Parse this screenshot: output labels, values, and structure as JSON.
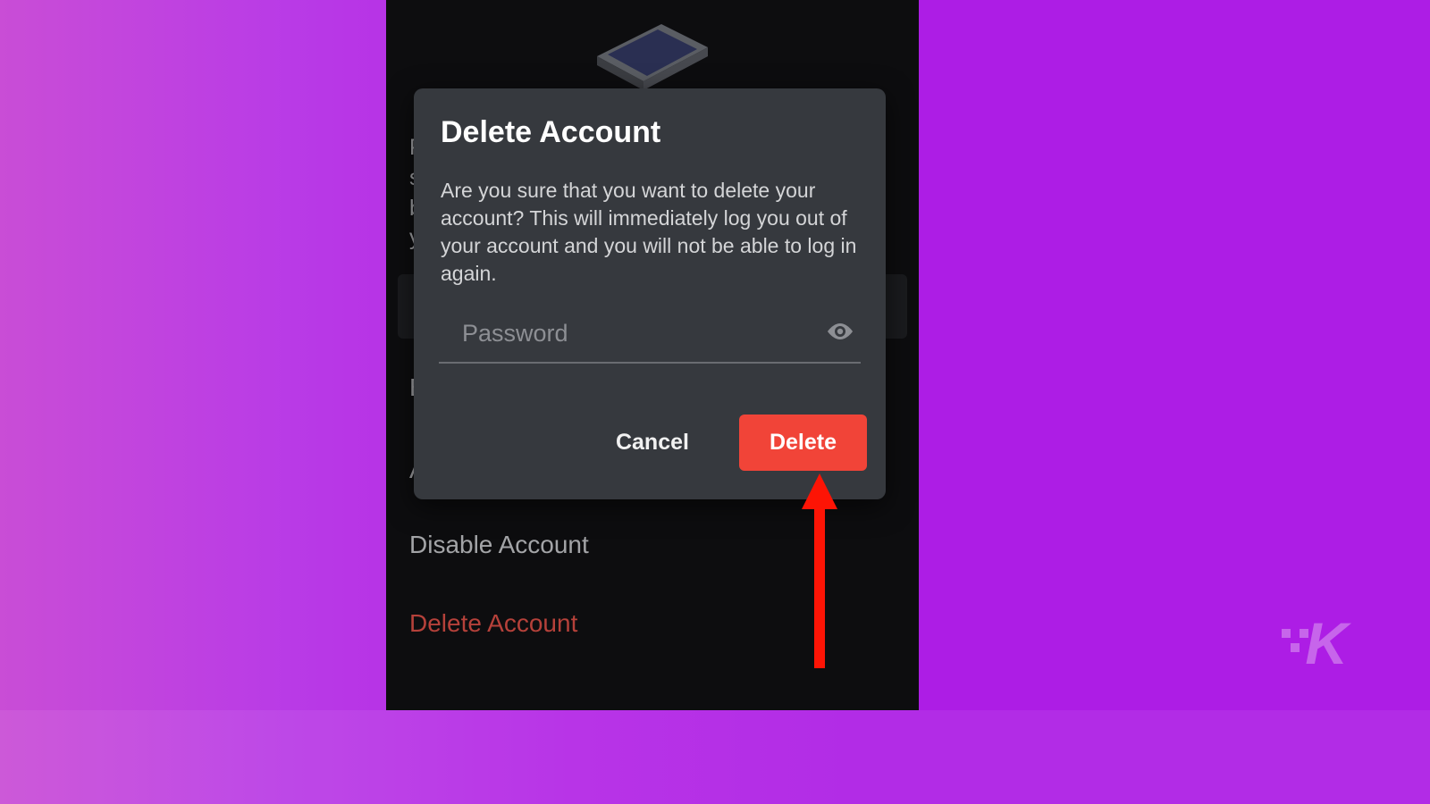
{
  "modal": {
    "title": "Delete Account",
    "description": "Are you sure that you want to delete your account? This will immediately log you out of your account and you will not be able to log in again.",
    "password_placeholder": "Password",
    "cancel_label": "Cancel",
    "delete_label": "Delete"
  },
  "background": {
    "partial_left_char1": "P",
    "partial_left_char2": "s",
    "partial_left_char3": "b",
    "partial_left_char4": "y",
    "partial_label_e": "E",
    "partial_label_a": "A",
    "disable_account": "Disable Account",
    "delete_account": "Delete Account"
  },
  "watermark": {
    "letter": "K"
  },
  "colors": {
    "gradient_start": "#c94dd6",
    "gradient_end": "#ad1de5",
    "panel_bg": "#0d0d0f",
    "modal_bg": "#36393e",
    "delete_btn": "#f14438",
    "arrow": "#fd1405"
  }
}
